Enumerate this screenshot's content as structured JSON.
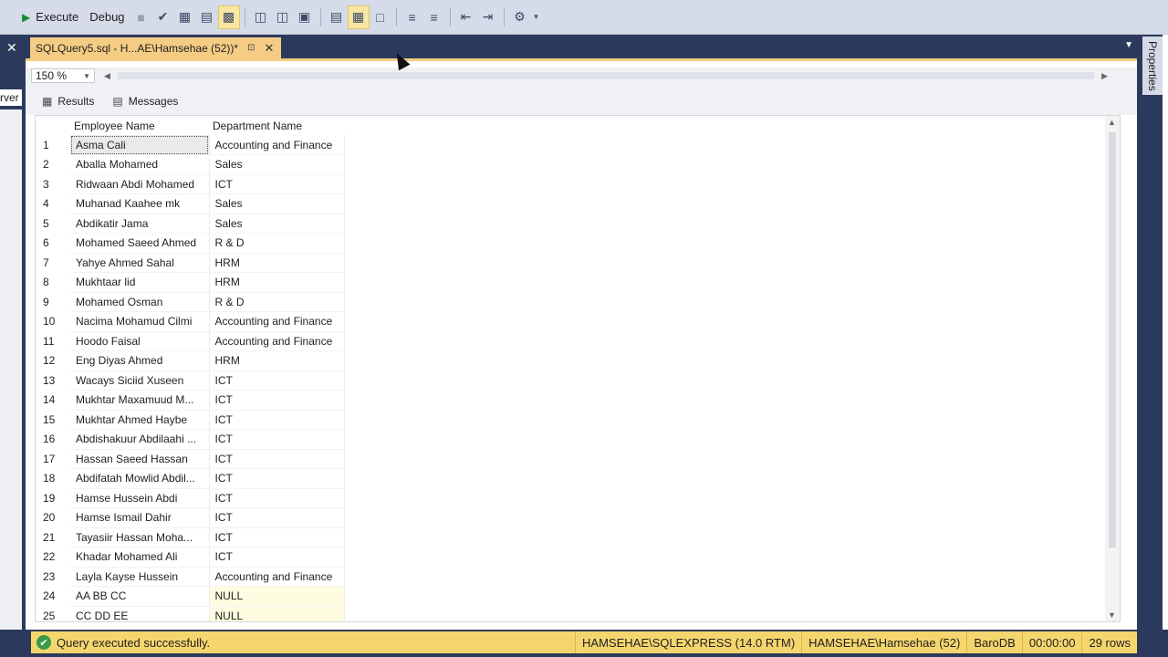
{
  "toolbar": {
    "execute_label": "Execute",
    "debug_label": "Debug"
  },
  "left_panel": {
    "clipped_text": "rver"
  },
  "doc_tab": {
    "title": "SQLQuery5.sql - H...AE\\Hamsehae (52))*"
  },
  "properties_label": "Properties",
  "editor": {
    "zoom": "150 %"
  },
  "result_tabs": {
    "results_label": "Results",
    "messages_label": "Messages"
  },
  "grid": {
    "columns": [
      "Employee Name",
      "Department Name"
    ],
    "rows": [
      [
        "1",
        "Asma Cali",
        "Accounting and Finance"
      ],
      [
        "2",
        "Aballa Mohamed",
        "Sales"
      ],
      [
        "3",
        "Ridwaan Abdi Mohamed",
        "ICT"
      ],
      [
        "4",
        "Muhanad Kaahee mk",
        "Sales"
      ],
      [
        "5",
        "Abdikatir Jama",
        "Sales"
      ],
      [
        "6",
        "Mohamed Saeed Ahmed",
        "R & D"
      ],
      [
        "7",
        "Yahye Ahmed Sahal",
        "HRM"
      ],
      [
        "8",
        "Mukhtaar lid",
        "HRM"
      ],
      [
        "9",
        "Mohamed Osman",
        "R & D"
      ],
      [
        "10",
        "Nacima Mohamud Cilmi",
        "Accounting and Finance"
      ],
      [
        "11",
        "Hoodo Faisal",
        "Accounting and Finance"
      ],
      [
        "12",
        "Eng Diyas Ahmed",
        "HRM"
      ],
      [
        "13",
        "Wacays Siciid Xuseen",
        "ICT"
      ],
      [
        "14",
        "Mukhtar Maxamuud M...",
        "ICT"
      ],
      [
        "15",
        "Mukhtar Ahmed Haybe",
        "ICT"
      ],
      [
        "16",
        "Abdishakuur Abdilaahi ...",
        "ICT"
      ],
      [
        "17",
        "Hassan Saeed Hassan",
        "ICT"
      ],
      [
        "18",
        "Abdifatah Mowlid Abdil...",
        "ICT"
      ],
      [
        "19",
        "Hamse Hussein Abdi",
        "ICT"
      ],
      [
        "20",
        "Hamse Ismail Dahir",
        "ICT"
      ],
      [
        "21",
        "Tayasiir Hassan Moha...",
        "ICT"
      ],
      [
        "22",
        "Khadar Mohamed Ali",
        "ICT"
      ],
      [
        "23",
        "Layla Kayse Hussein",
        "Accounting and Finance"
      ],
      [
        "24",
        "AA BB CC",
        "NULL"
      ],
      [
        "25",
        "CC DD EE",
        "NULL"
      ]
    ]
  },
  "status": {
    "message": "Query executed successfully.",
    "server": "HAMSEHAE\\SQLEXPRESS (14.0 RTM)",
    "user": "HAMSEHAE\\Hamsehae (52)",
    "database": "BaroDB",
    "elapsed": "00:00:00",
    "rows": "29 rows"
  },
  "colors": {
    "accent_tab": "#f5cc84",
    "status_bar": "#f5d66e",
    "frame": "#2b3a5c",
    "null_cell": "#fffde1"
  }
}
